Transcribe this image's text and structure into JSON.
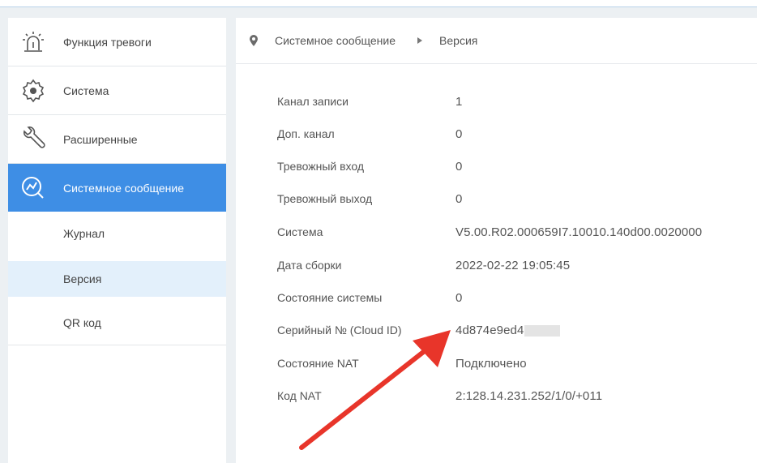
{
  "sidebar": {
    "items": [
      {
        "label": "Функция тревоги",
        "icon": "alarm-icon"
      },
      {
        "label": "Система",
        "icon": "gear-icon"
      },
      {
        "label": "Расширенные",
        "icon": "wrench-icon"
      },
      {
        "label": "Системное сообщение",
        "icon": "chart-icon",
        "active": true
      }
    ],
    "subitems": [
      {
        "label": "Журнал"
      },
      {
        "label": "Версия",
        "selected": true
      },
      {
        "label": "QR код"
      }
    ]
  },
  "breadcrumb": {
    "parent": "Системное сообщение",
    "current": "Версия"
  },
  "info": {
    "rows": [
      {
        "label": "Канал записи",
        "value": "1"
      },
      {
        "label": "Доп. канал",
        "value": "0"
      },
      {
        "label": "Тревожный вход",
        "value": "0"
      },
      {
        "label": "Тревожный выход",
        "value": "0"
      },
      {
        "label": "Система",
        "value": "V5.00.R02.000659I7.10010.140d00.0020000"
      },
      {
        "label": "Дата сборки",
        "value": "2022-02-22 19:05:45"
      },
      {
        "label": "Состояние системы",
        "value": "0"
      },
      {
        "label": "Серийный № (Cloud ID)",
        "value": "4d874e9ed4"
      },
      {
        "label": "Состояние NAT",
        "value": "Подключено"
      },
      {
        "label": "Код NAT",
        "value": "2:128.14.231.252/1/0/+011"
      }
    ]
  },
  "colors": {
    "accent": "#3e8ee5",
    "selected_bg": "#e3f0fb",
    "annotation_arrow": "#e8352a"
  }
}
